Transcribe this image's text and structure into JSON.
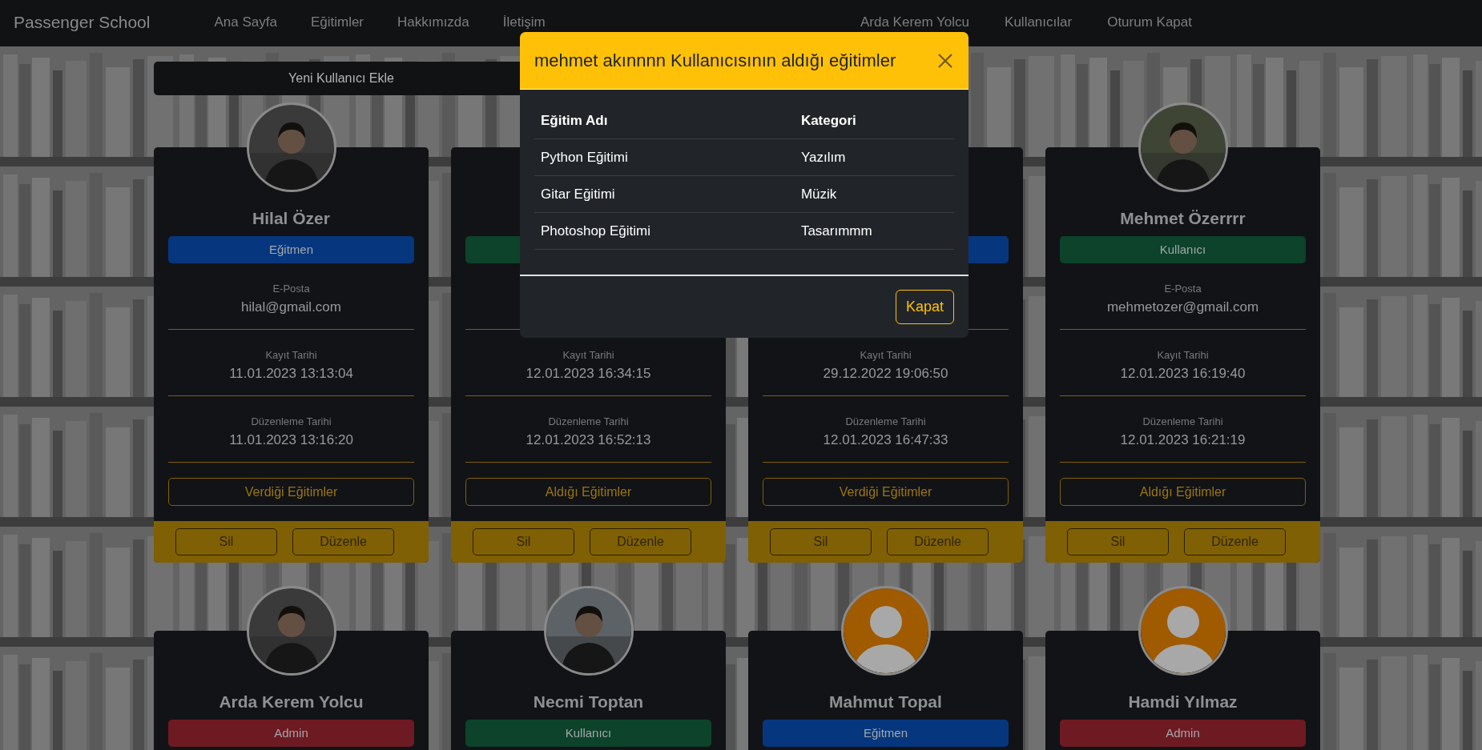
{
  "navbar": {
    "brand": "Passenger School",
    "links": [
      {
        "label": "Ana Sayfa"
      },
      {
        "label": "Eğitimler"
      },
      {
        "label": "Hakkımızda"
      },
      {
        "label": "İletişim"
      }
    ],
    "user_links": [
      {
        "label": "Arda Kerem Yolcu"
      },
      {
        "label": "Kullanıcılar"
      },
      {
        "label": "Oturum Kapat"
      }
    ]
  },
  "add_user_button": "Yeni Kullanıcı Ekle",
  "cards": [
    {
      "name": "Hilal Özer",
      "role": {
        "label": "Eğitmen",
        "color": "#06377e"
      },
      "email_label": "E-Posta",
      "email": "hilal@gmail.com",
      "registered_label": "Kayıt Tarihi",
      "registered": "11.01.2023 13:13:04",
      "edited_label": "Düzenleme Tarihi",
      "edited": "11.01.2023 13:16:20",
      "courses_button": "Verdiği Eğitimler",
      "delete_button": "Sil",
      "edit_button": "Düzenle"
    },
    {
      "role": {
        "color": "#0c432a"
      },
      "registered_label": "Kayıt Tarihi",
      "registered": "12.01.2023 16:34:15",
      "edited_label": "Düzenleme Tarihi",
      "edited": "12.01.2023 16:52:13",
      "courses_button": "Aldığı Eğitimler",
      "delete_button": "Sil",
      "edit_button": "Düzenle"
    },
    {
      "role": {
        "color": "#06377e"
      },
      "registered_label": "Kayıt Tarihi",
      "registered": "29.12.2022 19:06:50",
      "edited_label": "Düzenleme Tarihi",
      "edited": "12.01.2023 16:47:33",
      "courses_button": "Verdiği Eğitimler",
      "delete_button": "Sil",
      "edit_button": "Düzenle"
    },
    {
      "name": "Mehmet Özerrrr",
      "role": {
        "label": "Kullanıcı",
        "color": "#0c432a"
      },
      "email_label": "E-Posta",
      "email": "mehmetozer@gmail.com",
      "registered_label": "Kayıt Tarihi",
      "registered": "12.01.2023 16:19:40",
      "edited_label": "Düzenleme Tarihi",
      "edited": "12.01.2023 16:21:19",
      "courses_button": "Aldığı Eğitimler",
      "delete_button": "Sil",
      "edit_button": "Düzenle"
    },
    {
      "name": "Arda Kerem Yolcu",
      "role": {
        "label": "Admin",
        "color": "#6e1a22"
      }
    },
    {
      "name": "Necmi Toptan",
      "role": {
        "label": "Kullanıcı",
        "color": "#0c432a"
      }
    },
    {
      "avatar": {
        "kind": "default"
      },
      "name": "Mahmut Topal",
      "role": {
        "label": "Eğitmen",
        "color": "#06377e"
      }
    },
    {
      "avatar": {
        "kind": "default"
      },
      "name": "Hamdi Yılmaz",
      "role": {
        "label": "Admin",
        "color": "#6e1a22"
      }
    }
  ],
  "modal": {
    "title": "mehmet akınnnn Kullanıcısının aldığı eğitimler",
    "columns": [
      "Eğitim Adı",
      "Kategori"
    ],
    "rows": [
      [
        "Python Eğitimi",
        "Yazılım"
      ],
      [
        "Gitar Eğitimi",
        "Müzik"
      ],
      [
        "Photoshop Eğitimi",
        "Tasarımmm"
      ]
    ],
    "close_button": "Kapat"
  }
}
